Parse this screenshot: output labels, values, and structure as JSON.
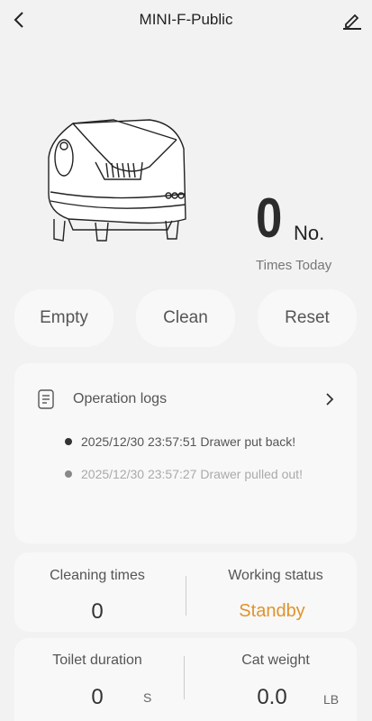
{
  "header": {
    "title": "MINI-F-Public"
  },
  "today": {
    "count": "0",
    "unit": "No.",
    "label": "Times Today"
  },
  "actions": {
    "empty": "Empty",
    "clean": "Clean",
    "reset": "Reset"
  },
  "logs": {
    "title": "Operation logs",
    "entries": [
      {
        "text": "2025/12/30 23:57:51 Drawer put back!"
      },
      {
        "text": "2025/12/30 23:57:27 Drawer pulled out!"
      }
    ]
  },
  "stats": {
    "cleaning_times_label": "Cleaning times",
    "cleaning_times_value": "0",
    "working_status_label": "Working status",
    "working_status_value": "Standby",
    "toilet_duration_label": "Toilet duration",
    "toilet_duration_value": "0",
    "toilet_duration_unit": "S",
    "cat_weight_label": "Cat weight",
    "cat_weight_value": "0.0",
    "cat_weight_unit": "LB"
  },
  "colors": {
    "background": "#f2f2f2",
    "card": "#f8f8f8",
    "status_accent": "#e0932c"
  },
  "icons": [
    "back-arrow-icon",
    "edit-pencil-icon",
    "document-icon",
    "chevron-right-icon"
  ]
}
